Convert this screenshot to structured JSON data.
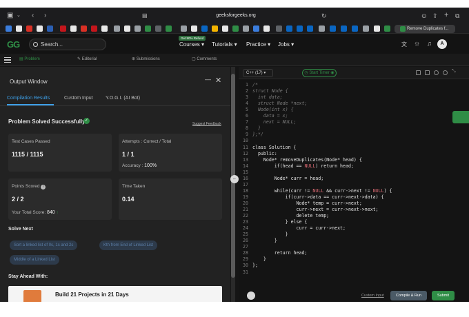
{
  "browser": {
    "url": "geeksforgeeks.org",
    "active_tab": "Remove Duplicates f..."
  },
  "header": {
    "logo": "GG",
    "search_placeholder": "Search...",
    "promo_badge": "Get 90% Refund",
    "nav": [
      "Courses",
      "Tutorials",
      "Practice",
      "Jobs"
    ],
    "avatar": "A"
  },
  "problem_tabs": [
    "Problem",
    "Editorial",
    "Submissions",
    "Comments"
  ],
  "output": {
    "title": "Output Window",
    "tabs": [
      "Compilation Results",
      "Custom Input",
      "Y.O.G.I. (AI Bot)"
    ],
    "status": "Problem Solved Successfully",
    "feedback": "Suggest Feedback",
    "cards": {
      "tests_label": "Test Cases Passed",
      "tests_value": "1115 / 1115",
      "attempts_label": "Attempts : Correct / Total",
      "attempts_value": "1 / 1",
      "accuracy_label": "Accuracy :",
      "accuracy_value": "100%",
      "points_label": "Points Scored",
      "points_value": "2 / 2",
      "total_label": "Your Total Score:",
      "total_value": "840",
      "time_label": "Time Taken",
      "time_value": "0.14"
    },
    "solve_next_title": "Solve Next",
    "solve_next": [
      "Sort a linked list of 0s, 1s and 2s",
      "Kth from End of Linked List",
      "Middle of a Linked List"
    ],
    "stay_ahead": "Stay Ahead With:",
    "promo_title": "Build 21 Projects in 21 Days"
  },
  "editor": {
    "language": "C++ (17)",
    "timer": "Start Timer",
    "lines": [
      "/*",
      "struct Node {",
      "  int data;",
      "  struct Node *next;",
      "  Node(int x) {",
      "    data = x;",
      "    next = NULL;",
      "  }",
      "};*/",
      "",
      "class Solution {",
      "  public:",
      "    Node* removeDuplicates(Node* head) {",
      "        if(head == NULL) return head;",
      "",
      "        Node* curr = head;",
      "",
      "        while(curr != NULL && curr->next != NULL) {",
      "            if(curr->data == curr->next->data) {",
      "                Node* temp = curr->next;",
      "                curr->next = curr->next->next;",
      "                delete temp;",
      "            } else {",
      "                curr = curr->next;",
      "            }",
      "        }",
      "",
      "        return head;",
      "    }",
      "};",
      ""
    ],
    "custom_input": "Custom Input",
    "compile_run": "Compile & Run",
    "submit": "Submit"
  }
}
